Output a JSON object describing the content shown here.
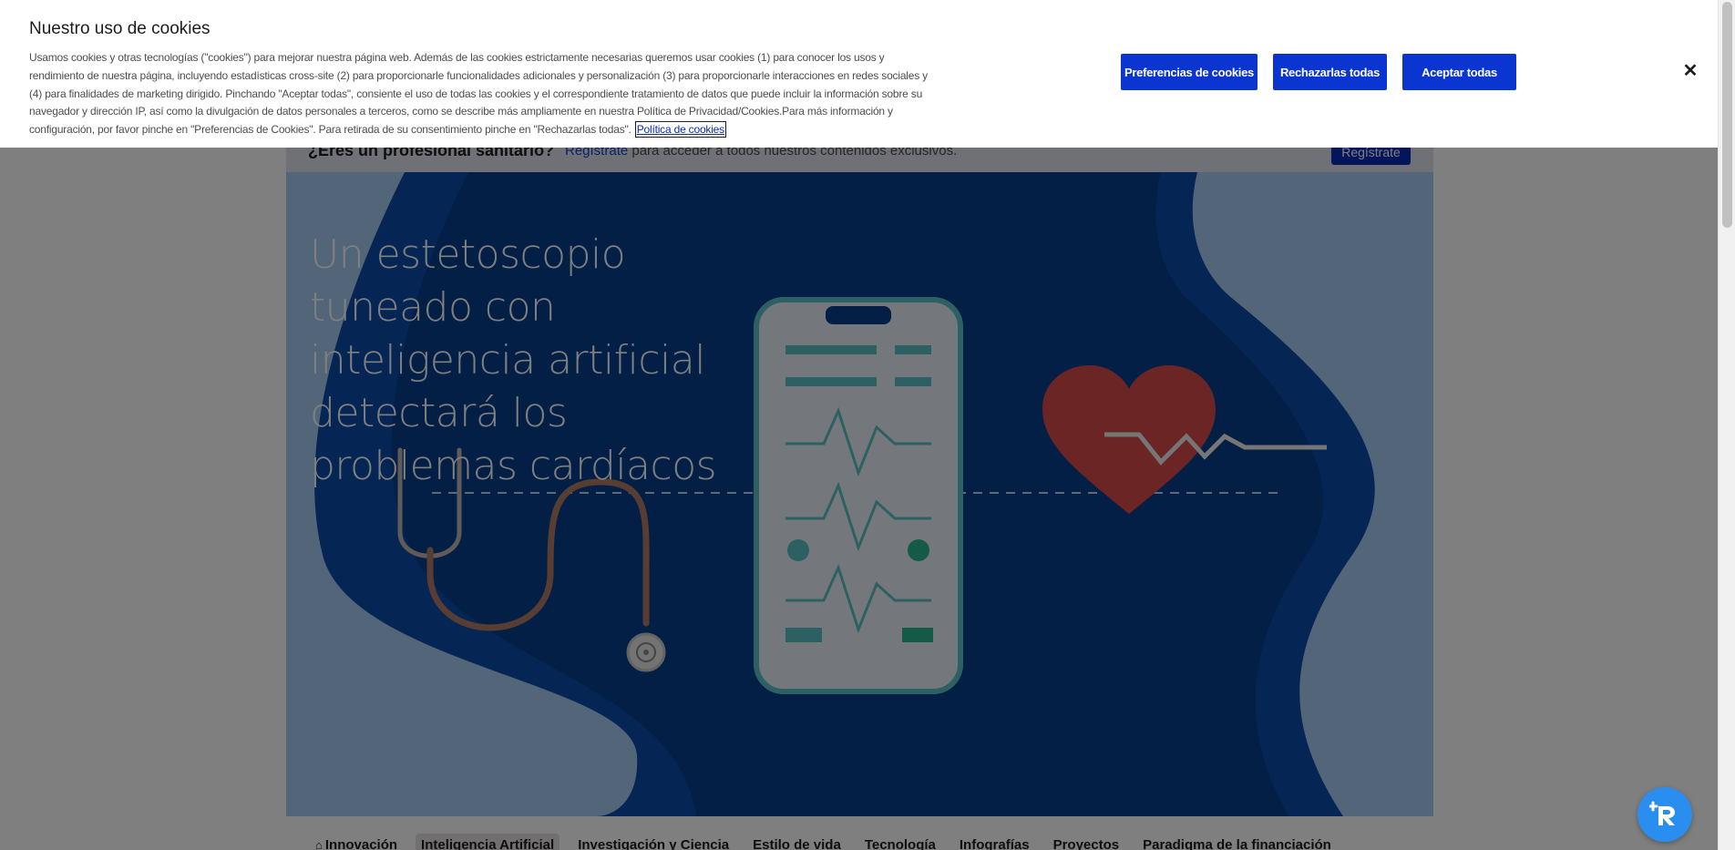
{
  "cookie_banner": {
    "title": "Nuestro uso de cookies",
    "body": "Usamos cookies y otras tecnologías (\"cookies\") para mejorar nuestra página web. Además de las cookies estrictamente necesarias queremos usar cookies (1) para conocer los usos y rendimiento de nuestra página, incluyendo estadísticas cross-site (2) para proporcionarle funcionalidades adicionales y personalización (3) para proporcionarle interacciones en redes sociales y (4) para finalidades de marketing dirigido. Pinchando \"Aceptar todas\", consiente el uso de todas las cookies y el correspondiente tratamiento de datos que puede incluir la información sobre su navegador y dirección IP, así como la divulgación de datos personales a terceros, como se describe más ampliamente en nuestra Política de Privacidad/Cookies.Para más información y configuración, por favor pinche en \"Preferencias de Cookies\". Para retirada de su consentimiento pinche en \"Rechazarlas todas\".",
    "policy_link": "Política de cookies",
    "buttons": {
      "preferences": "Preferencias de cookies",
      "reject_all": "Rechazarlas todas",
      "accept_all": "Aceptar todas"
    },
    "close_icon": "close-icon",
    "button_color": "#0a35d0"
  },
  "pro_bar": {
    "question": "¿Eres un profesional sanitario?",
    "link": "Regístrate",
    "text": " para acceder a todos nuestros contenidos exclusivos.",
    "button": "Regístrate"
  },
  "hero": {
    "title": "Un estetoscopio tuneado con inteligencia artificial detectará los problemas cardíacos"
  },
  "nav": {
    "items": [
      {
        "label": "Innovación",
        "icon": "home-icon"
      },
      {
        "label": "Inteligencia Artificial"
      },
      {
        "label": "Investigación y Ciencia"
      },
      {
        "label": "Estilo de vida"
      },
      {
        "label": "Tecnología"
      },
      {
        "label": "Infografías"
      },
      {
        "label": "Proyectos"
      },
      {
        "label": "Paradigma de la financiación"
      }
    ]
  },
  "chat": {
    "icon": "chat-assistant-icon"
  }
}
